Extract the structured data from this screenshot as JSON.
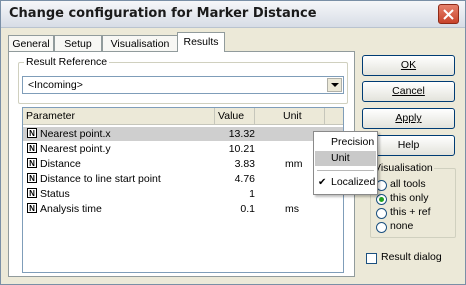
{
  "window": {
    "title": "Change configuration for Marker Distance"
  },
  "tabs": [
    {
      "label": "General"
    },
    {
      "label": "Setup"
    },
    {
      "label": "Visualisation"
    },
    {
      "label": "Results",
      "active": true
    }
  ],
  "result_reference": {
    "label": "Result Reference",
    "value": "<Incoming>"
  },
  "table": {
    "columns": [
      "Parameter",
      "Value",
      "Unit"
    ],
    "rows": [
      {
        "icon": "N",
        "parameter": "Nearest point.x",
        "value": "13.32",
        "unit": "",
        "selected": true
      },
      {
        "icon": "N",
        "parameter": "Nearest point.y",
        "value": "10.21",
        "unit": ""
      },
      {
        "icon": "N",
        "parameter": "Distance",
        "value": "3.83",
        "unit": "mm"
      },
      {
        "icon": "N",
        "parameter": "Distance to line start point",
        "value": "4.76",
        "unit": ""
      },
      {
        "icon": "N",
        "parameter": "Status",
        "value": "1",
        "unit": ""
      },
      {
        "icon": "N",
        "parameter": "Analysis time",
        "value": "0.1",
        "unit": "ms"
      }
    ]
  },
  "context_menu": {
    "items": [
      {
        "label": "Precision"
      },
      {
        "label": "Unit",
        "highlighted": true
      },
      {
        "label": "Localized",
        "checked": true,
        "check_mark": "✔"
      }
    ]
  },
  "buttons": {
    "ok": "OK",
    "cancel": "Cancel",
    "apply": "Apply",
    "help": "Help"
  },
  "visualisation": {
    "label": "Visualisation",
    "options": [
      {
        "label": "all tools",
        "checked": false
      },
      {
        "label": "this only",
        "checked": true
      },
      {
        "label": "this + ref",
        "checked": false
      },
      {
        "label": "none",
        "checked": false
      }
    ]
  },
  "result_dialog": {
    "label": "Result dialog",
    "checked": false
  },
  "colors": {
    "title_bar": "#dde3ea",
    "close_button": "#d2553c",
    "selection": "#cfcfcf",
    "dialog_bg": "#ece9d8"
  }
}
